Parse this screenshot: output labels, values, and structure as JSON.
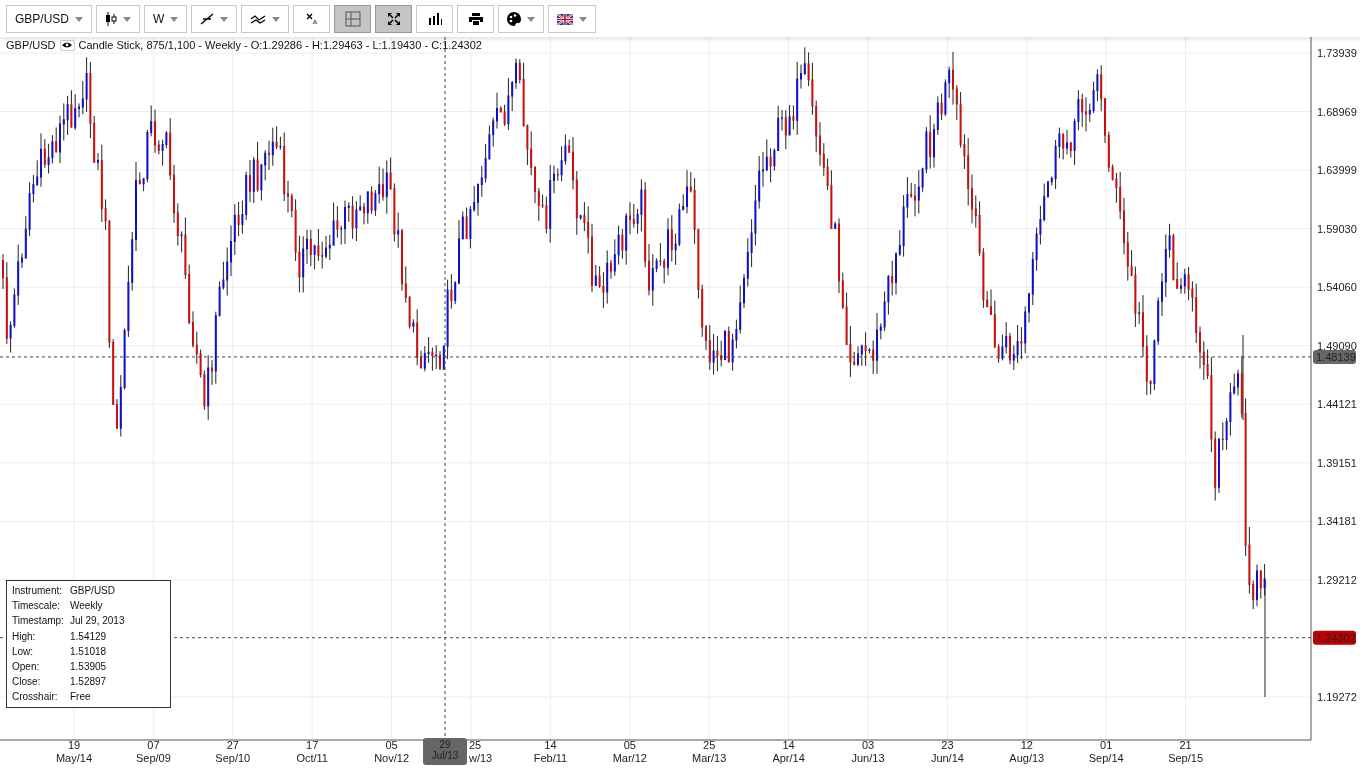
{
  "toolbar": [
    {
      "kind": "text",
      "label": "GBP/USD",
      "dropdown": true,
      "selected": false
    },
    {
      "kind": "candles",
      "dropdown": true,
      "selected": false
    },
    {
      "kind": "text",
      "label": "W",
      "dropdown": true,
      "selected": false
    },
    {
      "kind": "line-tool",
      "dropdown": true,
      "selected": false
    },
    {
      "kind": "indicator",
      "dropdown": true,
      "selected": false
    },
    {
      "kind": "clear",
      "dropdown": false,
      "selected": false
    },
    {
      "kind": "crosshair",
      "dropdown": false,
      "selected": true
    },
    {
      "kind": "fullscreen",
      "dropdown": false,
      "selected": true
    },
    {
      "kind": "volume",
      "dropdown": false,
      "selected": false
    },
    {
      "kind": "print",
      "dropdown": false,
      "selected": false
    },
    {
      "kind": "palette",
      "dropdown": true,
      "selected": false
    },
    {
      "kind": "flag",
      "dropdown": true,
      "selected": false
    }
  ],
  "legend": {
    "symbol": "GBP/USD",
    "description": "Candle Stick, 875/1,100 - Weekly - O:1.29286 - H:1.29463 - L:1.19430 - C:1.24302"
  },
  "price_axis": [
    "1.73939",
    "1.68969",
    "1.63999",
    "1.59030",
    "1.54060",
    "1.49090",
    "1.44121",
    "1.39151",
    "1.34181",
    "1.29212",
    "1.19272"
  ],
  "price_tags": [
    {
      "label": "1.48139",
      "kind": "marker"
    },
    {
      "label": "1.24302",
      "kind": "last"
    }
  ],
  "time_axis": [
    {
      "day": "19",
      "month": "May/14"
    },
    {
      "day": "07",
      "month": "Sep/09"
    },
    {
      "day": "27",
      "month": "Sep/10"
    },
    {
      "day": "17",
      "month": "Oct/11"
    },
    {
      "day": "05",
      "month": "Nov/12"
    },
    {
      "day": "25",
      "month": "w/13"
    },
    {
      "day": "14",
      "month": "Feb/11"
    },
    {
      "day": "05",
      "month": "Mar/12"
    },
    {
      "day": "25",
      "month": "Mar/13"
    },
    {
      "day": "14",
      "month": "Apr/14"
    },
    {
      "day": "03",
      "month": "Jun/13"
    },
    {
      "day": "23",
      "month": "Jun/14"
    },
    {
      "day": "12",
      "month": "Aug/13"
    },
    {
      "day": "01",
      "month": "Sep/14"
    },
    {
      "day": "21",
      "month": "Sep/15"
    }
  ],
  "crosshair_tag": {
    "day": "29",
    "month": "Jul/13"
  },
  "info_box": [
    {
      "label": "Instrument:",
      "value": "GBP/USD"
    },
    {
      "label": "Timescale:",
      "value": "Weekly"
    },
    {
      "label": "Timestamp:",
      "value": "Jul 29, 2013"
    },
    {
      "label": "High:",
      "value": "1.54129"
    },
    {
      "label": "Low:",
      "value": "1.51018"
    },
    {
      "label": "Open:",
      "value": "1.53905"
    },
    {
      "label": "Close:",
      "value": "1.52897"
    },
    {
      "label": "Crosshair:",
      "value": "Free"
    }
  ]
}
